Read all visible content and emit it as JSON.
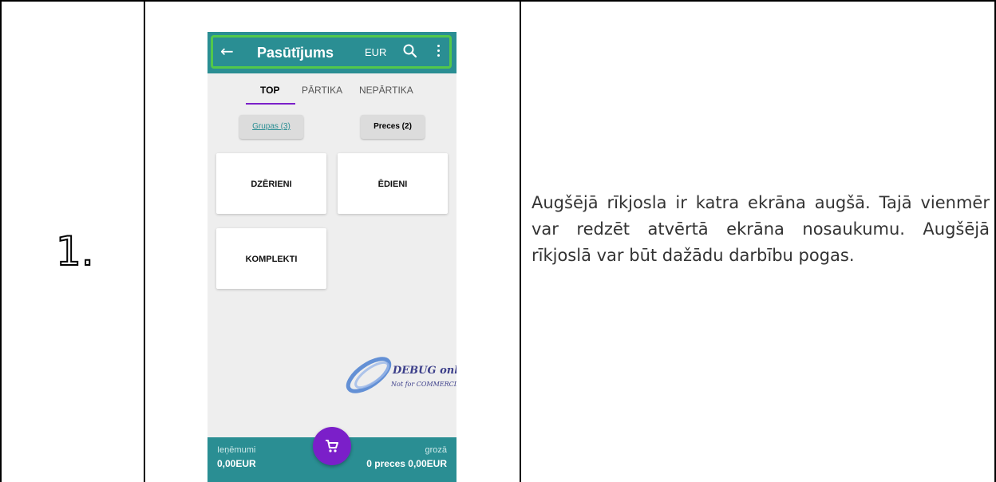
{
  "step": {
    "number": "1."
  },
  "app": {
    "title": "Pasūtījums",
    "currency": "EUR",
    "icons": {
      "back": "arrow-left-icon",
      "search": "search-icon",
      "menu": "more-vert-icon",
      "cart": "cart-icon"
    },
    "tabs": [
      {
        "label": "TOP",
        "active": true
      },
      {
        "label": "PĀRTIKA",
        "active": false
      },
      {
        "label": "NEPĀRTIKA",
        "active": false
      }
    ],
    "chips": {
      "groups": "Grupas (3)",
      "goods": "Preces (2)"
    },
    "cards": [
      "DZĒRIENI",
      "ĒDIENI",
      "KOMPLEKTI"
    ],
    "watermark": {
      "line1": "DEBUG only",
      "line2": "Not for COMMERCIAL"
    },
    "bottom": {
      "left_label": "Ieņēmumi",
      "left_value": "0,00EUR",
      "right_label": "grozā",
      "right_value": "0 preces 0,00EUR"
    },
    "colors": {
      "primary": "#2a8e93",
      "accent": "#7b1fc9",
      "highlight": "#52c84a"
    }
  },
  "description": "Augšējā rīkjosla ir katra ekrāna augšā. Tajā vienmēr var redzēt atvērtā ekrāna nosaukumu. Augšējā rīkjoslā var būt dažādu darbību pogas."
}
